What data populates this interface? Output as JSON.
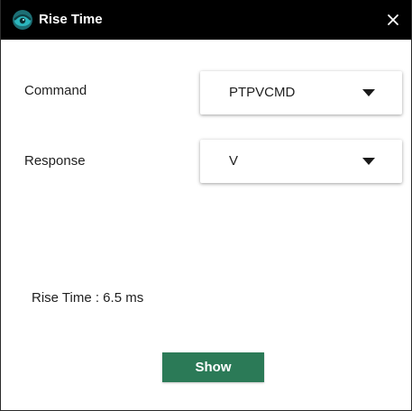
{
  "window": {
    "title": "Rise Time",
    "app_icon": "eye-logo-icon",
    "close_icon": "close-icon",
    "close_symbol": "✕"
  },
  "form": {
    "command_label": "Command",
    "command_value": "PTPVCMD",
    "response_label": "Response",
    "response_value": "V",
    "dropdown_icon": "caret-down-icon"
  },
  "result": {
    "text": "Rise Time : 6.5 ms"
  },
  "actions": {
    "show_label": "Show"
  },
  "colors": {
    "titlebar": "#000000",
    "button": "#2b7a57",
    "icon_accent": "#1fa9b0"
  }
}
